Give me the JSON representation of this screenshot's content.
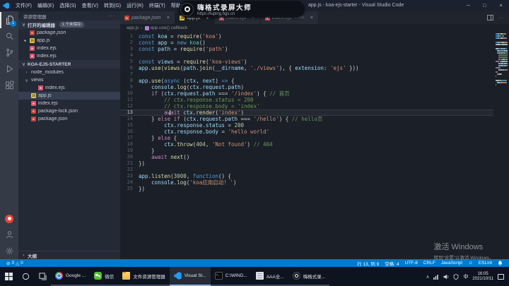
{
  "colors": {
    "accent": "#007acc",
    "status_bar": "#007acc",
    "title_bar": "#1c2130",
    "editor_bg": "#1b1f27"
  },
  "icons": {
    "ellipsis": "···",
    "chev_down": "∨",
    "chev_right": "›",
    "dirty": "●",
    "close": "×",
    "error": "⊘",
    "warning": "△",
    "smiley": "☺",
    "tray_chevron": "∧",
    "js_glyph": "JS",
    "json_glyph": "n",
    "ejs_glyph": "e"
  },
  "title_bar": {
    "app_title": "app.js - koa-ejs-starter - Visual Studio Code",
    "menus": [
      "文件(F)",
      "编辑(E)",
      "选择(S)",
      "查看(V)",
      "转到(G)",
      "运行(R)",
      "终端(T)",
      "帮助(H)"
    ],
    "window_controls": {
      "minimize": "─",
      "maximize": "□",
      "close": "×"
    }
  },
  "recorder_watermark": {
    "name": "嗨格式录屏大师",
    "url": "https://luping.hgs.cn"
  },
  "activity_bar": {
    "badge": "1"
  },
  "sidebar": {
    "title": "资源管理器",
    "open_editors": {
      "label": "打开的编辑器",
      "badge": "1 个未保存",
      "items": [
        {
          "icon": "json",
          "label": "package.json",
          "italic": true,
          "dirty": false
        },
        {
          "icon": "js",
          "label": "app.js",
          "italic": false,
          "dirty": true
        },
        {
          "icon": "ejs",
          "label": "index.ejs",
          "italic": false,
          "dirty": false
        },
        {
          "icon": "ejs",
          "label": "index.ejs",
          "italic": false,
          "dirty": false
        }
      ]
    },
    "project": {
      "label": "KOA-EJS-STARTER",
      "items": [
        {
          "type": "folder",
          "expanded": false,
          "label": "node_modules",
          "indent": 0
        },
        {
          "type": "folder",
          "expanded": true,
          "label": "views",
          "indent": 0
        },
        {
          "type": "file",
          "icon": "ejs",
          "label": "index.ejs",
          "indent": 1
        },
        {
          "type": "file",
          "icon": "js",
          "label": "app.js",
          "indent": 0,
          "selected": true
        },
        {
          "type": "file",
          "icon": "ejs",
          "label": "index.ejs",
          "indent": 0
        },
        {
          "type": "file",
          "icon": "json",
          "label": "package-lock.json",
          "indent": 0
        },
        {
          "type": "file",
          "icon": "json",
          "label": "package.json",
          "indent": 0
        }
      ]
    },
    "outline": {
      "label": "大纲"
    }
  },
  "editor": {
    "tabs": [
      {
        "label": "package.json",
        "icon": "json",
        "italic": true,
        "active": false,
        "dirty": false,
        "desc": ""
      },
      {
        "label": "app.js",
        "icon": "js",
        "italic": false,
        "active": true,
        "dirty": true,
        "desc": ""
      },
      {
        "label": "index.ejs",
        "icon": "ejs",
        "italic": false,
        "active": false,
        "dirty": false,
        "desc": ""
      },
      {
        "label": "index.ejs",
        "icon": "ejs",
        "italic": false,
        "active": false,
        "dirty": false,
        "desc": "views"
      }
    ],
    "breadcrumbs": [
      "app.js",
      "app.use() callback"
    ],
    "active_line": 13,
    "cursor_col": 9,
    "lines": [
      {
        "segs": [
          [
            "kw",
            "const"
          ],
          [
            "d",
            " "
          ],
          [
            "v",
            "koa"
          ],
          [
            "d",
            " = "
          ],
          [
            "fn",
            "require"
          ],
          [
            "d",
            "("
          ],
          [
            "s",
            "'koa'"
          ],
          [
            "d",
            ")"
          ]
        ]
      },
      {
        "segs": [
          [
            "kw",
            "const"
          ],
          [
            "d",
            " "
          ],
          [
            "v",
            "app"
          ],
          [
            "d",
            " = "
          ],
          [
            "kw",
            "new"
          ],
          [
            "d",
            " "
          ],
          [
            "cl",
            "koa"
          ],
          [
            "d",
            "()"
          ]
        ]
      },
      {
        "segs": [
          [
            "kw",
            "const"
          ],
          [
            "d",
            " "
          ],
          [
            "v",
            "path"
          ],
          [
            "d",
            " = "
          ],
          [
            "fn",
            "require"
          ],
          [
            "d",
            "("
          ],
          [
            "s",
            "'path'"
          ],
          [
            "d",
            ")"
          ]
        ]
      },
      {
        "segs": []
      },
      {
        "segs": [
          [
            "kw",
            "const"
          ],
          [
            "d",
            " "
          ],
          [
            "v",
            "views"
          ],
          [
            "d",
            " = "
          ],
          [
            "fn",
            "require"
          ],
          [
            "d",
            "("
          ],
          [
            "s",
            "'koa-views'"
          ],
          [
            "d",
            ")"
          ]
        ]
      },
      {
        "segs": [
          [
            "v",
            "app"
          ],
          [
            "d",
            "."
          ],
          [
            "fn",
            "use"
          ],
          [
            "d",
            "("
          ],
          [
            "fn",
            "views"
          ],
          [
            "d",
            "("
          ],
          [
            "v",
            "path"
          ],
          [
            "d",
            "."
          ],
          [
            "fn",
            "join"
          ],
          [
            "d",
            "("
          ],
          [
            "v",
            "__dirname"
          ],
          [
            "d",
            ", "
          ],
          [
            "s",
            "'./views'"
          ],
          [
            "d",
            "), { "
          ],
          [
            "v",
            "extension"
          ],
          [
            "d",
            ": "
          ],
          [
            "s",
            "'ejs'"
          ],
          [
            "d",
            " }))"
          ]
        ]
      },
      {
        "segs": []
      },
      {
        "segs": [
          [
            "v",
            "app"
          ],
          [
            "d",
            "."
          ],
          [
            "fn",
            "use"
          ],
          [
            "d",
            "("
          ],
          [
            "kw",
            "async"
          ],
          [
            "d",
            " ("
          ],
          [
            "v",
            "ctx"
          ],
          [
            "d",
            ", "
          ],
          [
            "v",
            "next"
          ],
          [
            "d",
            ") "
          ],
          [
            "kw",
            "=>"
          ],
          [
            "d",
            " {"
          ]
        ]
      },
      {
        "segs": [
          [
            "d",
            "    "
          ],
          [
            "v",
            "console"
          ],
          [
            "d",
            "."
          ],
          [
            "fn",
            "log"
          ],
          [
            "d",
            "("
          ],
          [
            "v",
            "ctx"
          ],
          [
            "d",
            "."
          ],
          [
            "v",
            "request"
          ],
          [
            "d",
            "."
          ],
          [
            "v",
            "path"
          ],
          [
            "d",
            ")"
          ]
        ]
      },
      {
        "segs": [
          [
            "d",
            "    "
          ],
          [
            "ct",
            "if"
          ],
          [
            "d",
            " ("
          ],
          [
            "v",
            "ctx"
          ],
          [
            "d",
            "."
          ],
          [
            "v",
            "request"
          ],
          [
            "d",
            "."
          ],
          [
            "v",
            "path"
          ],
          [
            "d",
            " === "
          ],
          [
            "s",
            "'/index'"
          ],
          [
            "d",
            ") { "
          ],
          [
            "cm",
            "// 首页"
          ]
        ]
      },
      {
        "segs": [
          [
            "d",
            "        "
          ],
          [
            "cm",
            "// ctx.response.status = 200"
          ]
        ]
      },
      {
        "segs": [
          [
            "d",
            "        "
          ],
          [
            "cm",
            "// ctx.response.body = 'index'"
          ]
        ]
      },
      {
        "segs": [
          [
            "d",
            "        "
          ],
          [
            "ct",
            "await"
          ],
          [
            "d",
            " "
          ],
          [
            "v",
            "ctx"
          ],
          [
            "d",
            "."
          ],
          [
            "fn",
            "render"
          ],
          [
            "d",
            "("
          ],
          [
            "s",
            "'index'"
          ],
          [
            "d",
            ")"
          ]
        ]
      },
      {
        "segs": [
          [
            "d",
            "    } "
          ],
          [
            "ct",
            "else"
          ],
          [
            "d",
            " "
          ],
          [
            "ct",
            "if"
          ],
          [
            "d",
            " ("
          ],
          [
            "v",
            "ctx"
          ],
          [
            "d",
            "."
          ],
          [
            "v",
            "request"
          ],
          [
            "d",
            "."
          ],
          [
            "v",
            "path"
          ],
          [
            "d",
            " === "
          ],
          [
            "s",
            "'/hello'"
          ],
          [
            "d",
            ") { "
          ],
          [
            "cm",
            "// hello页"
          ]
        ]
      },
      {
        "segs": [
          [
            "d",
            "        "
          ],
          [
            "v",
            "ctx"
          ],
          [
            "d",
            "."
          ],
          [
            "v",
            "response"
          ],
          [
            "d",
            "."
          ],
          [
            "v",
            "status"
          ],
          [
            "d",
            " = "
          ],
          [
            "n",
            "200"
          ]
        ]
      },
      {
        "segs": [
          [
            "d",
            "        "
          ],
          [
            "v",
            "ctx"
          ],
          [
            "d",
            "."
          ],
          [
            "v",
            "response"
          ],
          [
            "d",
            "."
          ],
          [
            "v",
            "body"
          ],
          [
            "d",
            " = "
          ],
          [
            "s",
            "'hello world'"
          ]
        ]
      },
      {
        "segs": [
          [
            "d",
            "    } "
          ],
          [
            "ct",
            "else"
          ],
          [
            "d",
            " {"
          ]
        ]
      },
      {
        "segs": [
          [
            "d",
            "        "
          ],
          [
            "v",
            "ctx"
          ],
          [
            "d",
            "."
          ],
          [
            "fn",
            "throw"
          ],
          [
            "d",
            "("
          ],
          [
            "n",
            "404"
          ],
          [
            "d",
            ", "
          ],
          [
            "s",
            "'Not found'"
          ],
          [
            "d",
            ") "
          ],
          [
            "cm",
            "// 404"
          ]
        ]
      },
      {
        "segs": [
          [
            "d",
            "    }"
          ]
        ]
      },
      {
        "segs": [
          [
            "d",
            "    "
          ],
          [
            "ct",
            "await"
          ],
          [
            "d",
            " "
          ],
          [
            "fn",
            "next"
          ],
          [
            "d",
            "()"
          ]
        ]
      },
      {
        "segs": [
          [
            "d",
            "})"
          ]
        ]
      },
      {
        "segs": []
      },
      {
        "segs": [
          [
            "v",
            "app"
          ],
          [
            "d",
            "."
          ],
          [
            "fn",
            "listen"
          ],
          [
            "d",
            "("
          ],
          [
            "n",
            "3000"
          ],
          [
            "d",
            ", "
          ],
          [
            "kw",
            "function"
          ],
          [
            "d",
            "() {"
          ]
        ]
      },
      {
        "segs": [
          [
            "d",
            "    "
          ],
          [
            "v",
            "console"
          ],
          [
            "d",
            "."
          ],
          [
            "fn",
            "log"
          ],
          [
            "d",
            "("
          ],
          [
            "s",
            "'koa应用启动! '"
          ],
          [
            "d",
            ")"
          ]
        ]
      },
      {
        "segs": [
          [
            "d",
            "})"
          ]
        ]
      }
    ]
  },
  "status_bar": {
    "errors": "0",
    "warnings": "0",
    "right": [
      {
        "label": "行 13, 列 9",
        "name": "cursor-position"
      },
      {
        "label": "空格: 4",
        "name": "indentation"
      },
      {
        "label": "UTF-8",
        "name": "encoding"
      },
      {
        "label": "CRLF",
        "name": "eol"
      },
      {
        "label": "JavaScript",
        "name": "language-mode"
      },
      {
        "icon": "smiley",
        "name": "feedback-smiley-icon"
      },
      {
        "label": "ESLint",
        "name": "eslint-status"
      },
      {
        "icon": "bell",
        "name": "notifications-bell-icon"
      }
    ]
  },
  "taskbar": {
    "apps": [
      {
        "label": "Google ...",
        "icon": "chrome"
      },
      {
        "label": "微信",
        "icon": "wechat"
      },
      {
        "label": "文件资源管理器",
        "icon": "explorer"
      },
      {
        "label": "Visual St...",
        "icon": "vscode",
        "active": true
      },
      {
        "label": "C:\\WIND...",
        "icon": "cmd"
      },
      {
        "label": "AAA全...",
        "icon": "doc"
      },
      {
        "label": "嗨格式录...",
        "icon": "recorder"
      }
    ],
    "tray": {
      "input": "中",
      "time": "16:05",
      "date": "2021/10/11"
    }
  },
  "activation_watermark": {
    "line1": "激活 Windows",
    "line2": "转到“设置”以激活 Windows。"
  }
}
